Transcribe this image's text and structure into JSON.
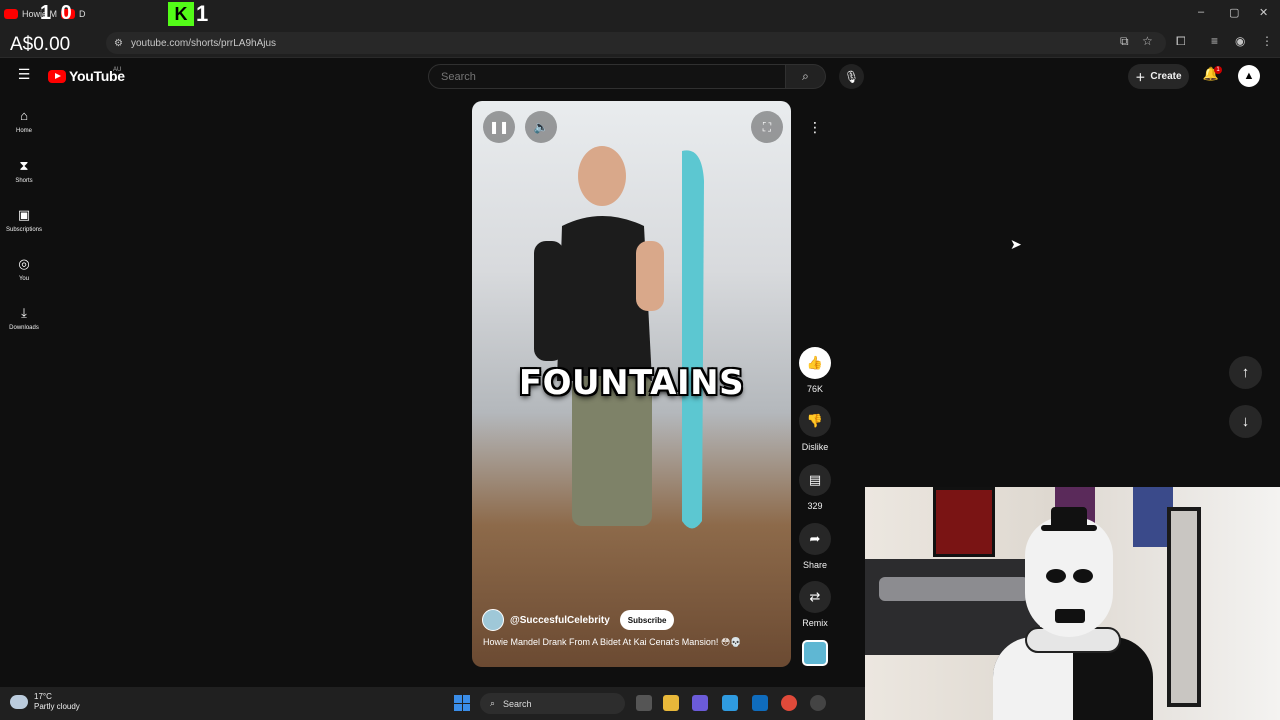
{
  "browser": {
    "tab_title": "Howie M",
    "tab_title_2": "D",
    "overlay_numbers": "1  0",
    "kick_badge": "K",
    "kick_count": "1",
    "url": "youtube.com/shorts/prrLA9hAjus",
    "window_controls": [
      "–",
      "▢",
      "✕"
    ]
  },
  "stream_overlay": {
    "balance": "A$0.00"
  },
  "youtube": {
    "logo_text": "YouTube",
    "region": "AU",
    "search_placeholder": "Search",
    "create_label": "Create",
    "notification_count": "1"
  },
  "sidebar": {
    "items": [
      {
        "label": "Home",
        "icon": "home-icon"
      },
      {
        "label": "Shorts",
        "icon": "shorts-icon"
      },
      {
        "label": "Subscriptions",
        "icon": "subscriptions-icon"
      },
      {
        "label": "You",
        "icon": "you-icon"
      },
      {
        "label": "Downloads",
        "icon": "downloads-icon"
      }
    ]
  },
  "short": {
    "caption": "FOUNTAINS",
    "channel": "@SuccesfulCelebrity",
    "subscribe_label": "Subscribe",
    "title": "Howie Mandel Drank From A Bidet At Kai Cenat's Mansion! 😳💀",
    "actions": {
      "likes": "76K",
      "dislike_label": "Dislike",
      "comments": "329",
      "share_label": "Share",
      "remix_label": "Remix"
    }
  },
  "taskbar": {
    "temperature": "17°C",
    "weather": "Partly cloudy",
    "search_label": "Search"
  },
  "colors": {
    "background": "#0f0f0f",
    "youtube_red": "#ff0000",
    "kick_green": "#53fc18",
    "windows_blue": "#3a8de8"
  }
}
